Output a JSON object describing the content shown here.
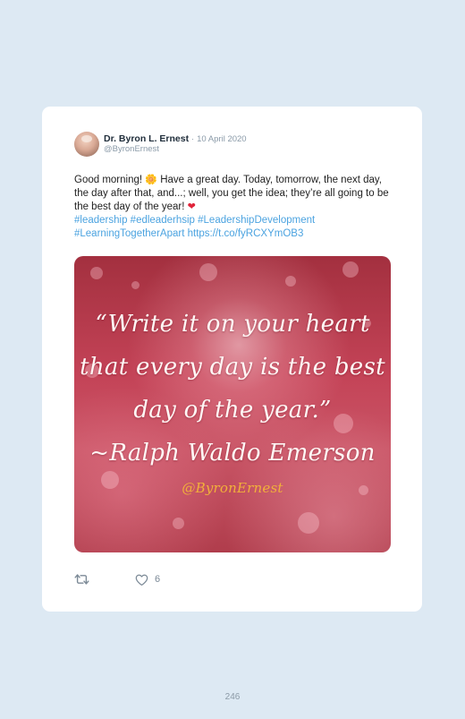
{
  "tweet": {
    "display_name": "Dr. Byron L. Ernest",
    "separator": "·",
    "date": "10 April 2020",
    "handle": "@ByronErnest",
    "text_part1": "Good morning!",
    "sun_emoji": "🌼",
    "text_part2": "Have a great day. Today, tomorrow, the next day, the day after that, and...; well, you get the idea; they’re all going to be the best day of the year!",
    "heart_emoji": "❤",
    "hashtags": [
      "#leadership",
      "#edleaderhsip",
      "#LeadershipDevelopment",
      "#LearningTogetherApart"
    ],
    "url": "https://t.co/fyRCXYmOB3"
  },
  "media": {
    "quote_lines": [
      "“Write it on your heart",
      "that every day is the best",
      "day of the year.”",
      "~Ralph Waldo Emerson"
    ],
    "watermark": "@ByronErnest"
  },
  "actions": {
    "retweet_icon": "retweet-icon",
    "like_icon": "heart-outline-icon",
    "like_count": "6"
  },
  "page_number": "246",
  "colors": {
    "background": "#dde9f3",
    "card": "#ffffff",
    "link": "#4ba3e0",
    "watermark": "#f2b03a"
  }
}
